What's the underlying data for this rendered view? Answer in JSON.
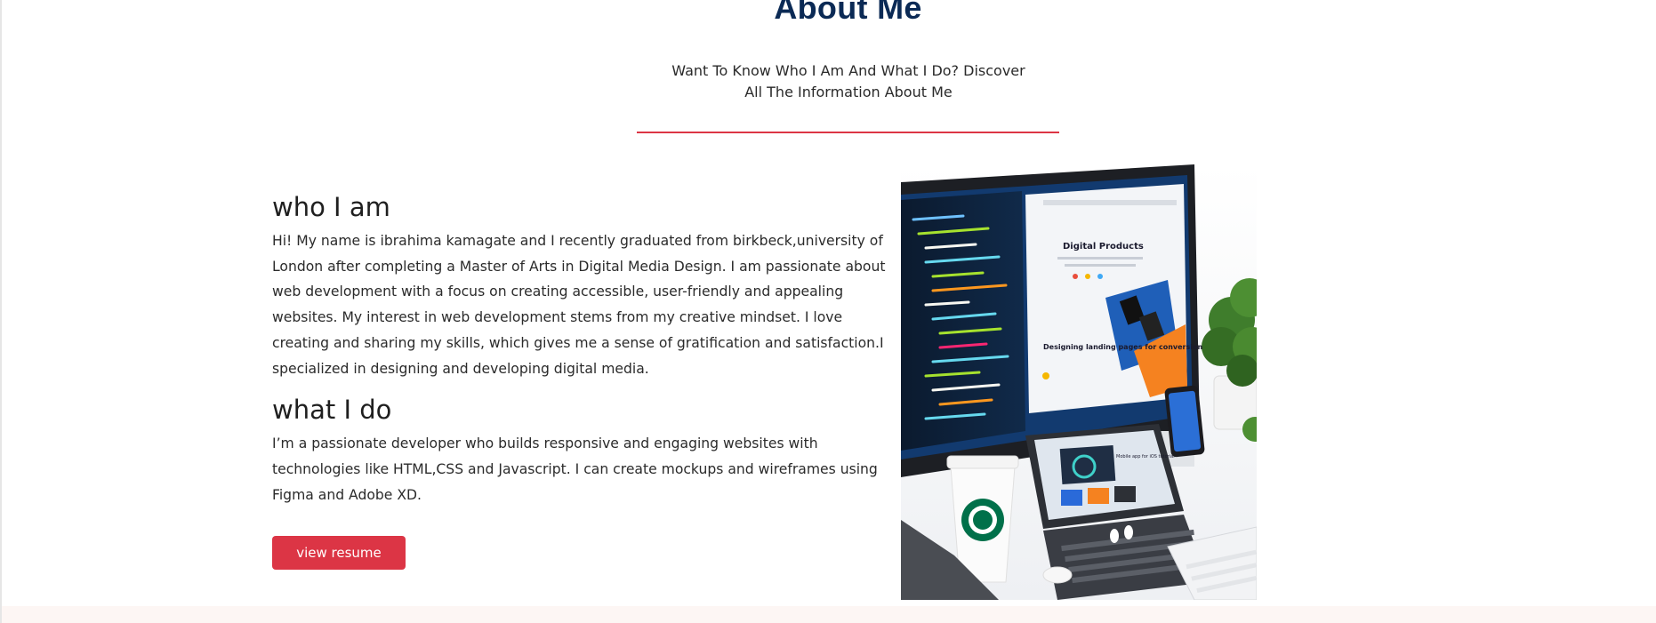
{
  "about": {
    "title": "About Me",
    "subtitle": "Want To Know Who I Am And What I Do? Discover All The Information About Me"
  },
  "who": {
    "heading": "who I am",
    "text": "Hi! My name is ibrahima kamagate and I recently graduated from birkbeck,university of London after completing a Master of Arts in Digital Media Design. I am passionate about web development with a focus on creating accessible, user-friendly and appealing websites. My interest in web development stems from my creative mindset. I love creating and sharing my skills, which gives me a sense of gratification and satisfaction.I specialized in designing and developing digital media."
  },
  "what": {
    "heading": "what I do",
    "text": "I’m a passionate developer who builds responsive and engaging websites with technologies like HTML,CSS and Javascript. I can create mockups and wireframes using Figma and Adobe XD."
  },
  "resume_button": "view resume",
  "image": {
    "screen_heading": "Digital Products",
    "screen_text": "Designing landing pages for conversion",
    "tablet_text": "Mobile app for iOS tutorial"
  },
  "colors": {
    "title": "#0b2a55",
    "accent": "#dc3545"
  }
}
